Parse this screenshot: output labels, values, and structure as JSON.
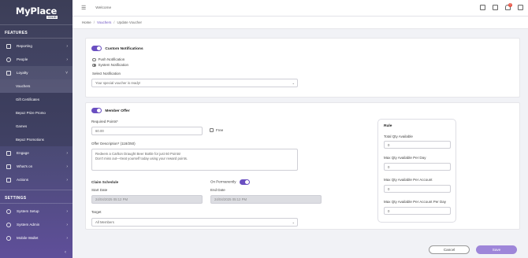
{
  "brand": {
    "main": "MyPlace",
    "sub": "COLIO"
  },
  "sidebar": {
    "features_label": "FEATURES",
    "settings_label": "SETTINGS",
    "items": [
      {
        "label": "Reporting"
      },
      {
        "label": "People"
      },
      {
        "label": "Loyalty"
      },
      {
        "label": "Engage"
      },
      {
        "label": "What's on"
      },
      {
        "label": "Actions"
      }
    ],
    "loyalty_sub": [
      {
        "label": "Vouchers"
      },
      {
        "label": "Gift Certificates"
      },
      {
        "label": "Bepoz Prize Promo"
      },
      {
        "label": "Games"
      },
      {
        "label": "Bepoz Promotions"
      }
    ],
    "settings_items": [
      {
        "label": "System Setup"
      },
      {
        "label": "System Admin"
      },
      {
        "label": "Mobile Wallet"
      }
    ]
  },
  "topbar": {
    "welcome": "Welcome",
    "notification_count": "0"
  },
  "breadcrumb": {
    "home": "Home",
    "vouchers": "Vouchers",
    "current": "Update Voucher"
  },
  "custom_notifications": {
    "title": "Custom Notifications",
    "push_label": "Push Notification",
    "system_label": "System Notification",
    "select_label": "Select Notification",
    "select_value": "Your special voucher is ready!"
  },
  "member_offer": {
    "title": "Member Offer",
    "required_points_label": "Required Points*",
    "required_points_value": "60.00",
    "free_label": "Free",
    "description_label": "Offer Description* (118/250)",
    "description_line1": "Redeem a Carlton Draught Beer Bottle for just 60 Points!",
    "description_line2": "Don't miss out—treat yourself today using your reward points.",
    "claim_schedule_label": "Claim Schedule",
    "on_permanently_label": "On Permanently",
    "start_date_label": "Start Date",
    "start_date_value": "24/04/2025 05:12 PM",
    "end_date_label": "End Date",
    "end_date_value": "24/04/2025 05:12 PM",
    "target_label": "Target",
    "target_value": "All Members"
  },
  "rule": {
    "title": "Rule",
    "total_qty_label": "Total Qty Available",
    "total_qty_value": "0",
    "max_per_day_label": "Max Qty Available Per Day",
    "max_per_day_value": "0",
    "max_per_account_label": "Max Qty Available Per Account",
    "max_per_account_value": "0",
    "max_per_account_day_label": "Max Qty Available Per Account Per Day",
    "max_per_account_day_value": "0"
  },
  "actions": {
    "cancel": "Cancel",
    "save": "Save"
  },
  "colors": {
    "accent": "#6a4fc1",
    "save_button": "#9e86d9",
    "sidebar_top": "#3c3e57",
    "sidebar_bottom": "#5f4f9a"
  }
}
